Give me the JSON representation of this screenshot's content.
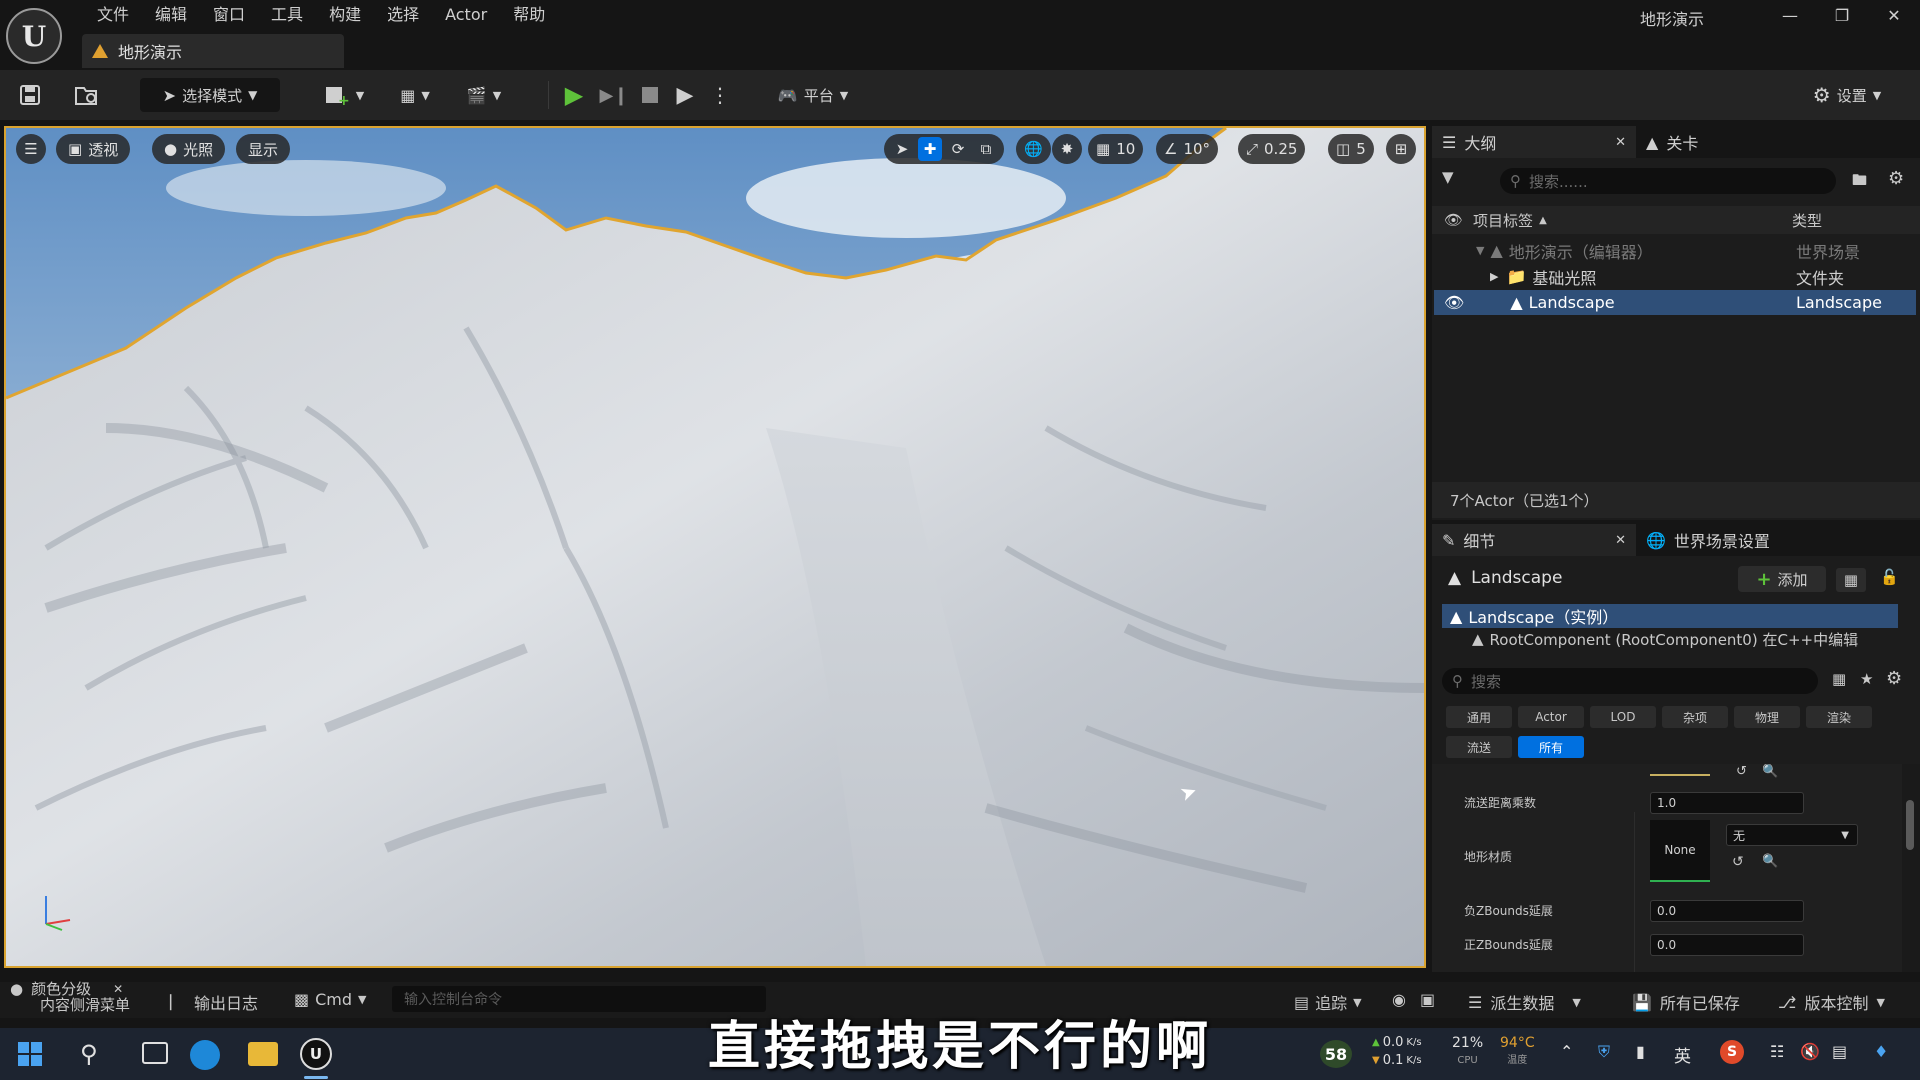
{
  "app": {
    "logo_letter": "U",
    "window_title": "地形演示",
    "menu": [
      "文件",
      "编辑",
      "窗口",
      "工具",
      "构建",
      "选择",
      "Actor",
      "帮助"
    ],
    "doc_tab": "地形演示"
  },
  "toolbar": {
    "select_mode": "选择模式",
    "platform": "平台",
    "settings": "设置"
  },
  "viewport": {
    "perspective": "透视",
    "lighting": "光照",
    "show": "显示",
    "grid_snap": "10",
    "rotate_snap": "10°",
    "scale_snap": "0.25",
    "camera_speed": "5"
  },
  "outliner": {
    "tab_outliner": "大纲",
    "tab_levels": "关卡",
    "search_placeholder": "搜索......",
    "col_label": "项目标签",
    "col_type": "类型",
    "rows": [
      {
        "label": "地形演示（编辑器）",
        "type": "世界场景"
      },
      {
        "label": "基础光照",
        "type": "文件夹"
      },
      {
        "label": "Landscape",
        "type": "Landscape"
      }
    ],
    "footer": "7个Actor（已选1个）"
  },
  "details": {
    "tab_details": "细节",
    "tab_world_settings": "世界场景设置",
    "actor_name": "Landscape",
    "add_label": "添加",
    "instance": "Landscape（实例）",
    "component": "RootComponent (RootComponent0)  在C++中编辑",
    "search_placeholder": "搜索",
    "categories_row1": [
      "通用",
      "Actor",
      "LOD",
      "杂项",
      "物理",
      "渲染"
    ],
    "categories_row2": [
      "流送",
      "所有"
    ],
    "active_category": "所有",
    "props": {
      "streaming_distance_label": "流送距离乘数",
      "streaming_distance_value": "1.0",
      "material_label": "地形材质",
      "material_thumb": "None",
      "material_value": "无",
      "neg_z_label": "负ZBounds延展",
      "neg_z_value": "0.0",
      "pos_z_label": "正ZBounds延展",
      "pos_z_value": "0.0"
    }
  },
  "statusbar": {
    "color_grade": "颜色分级",
    "content_menu": "内容侧滑菜单",
    "output_log": "输出日志",
    "cmd": "Cmd",
    "cmd_placeholder": "输入控制台命令",
    "trace": "追踪",
    "derived_data": "派生数据",
    "all_saved": "所有已保存",
    "source_control": "版本控制"
  },
  "taskbar": {
    "fps_badge": "58",
    "net_up": "0.0",
    "net_down": "0.1",
    "net_unit": "K/s",
    "cpu_value": "21%",
    "cpu_label": "CPU",
    "temp_value": "94°C",
    "temp_label": "温度",
    "ime": "英"
  },
  "subtitle": "直接拖拽是不行的啊",
  "colors": {
    "accent_orange": "#d9a330",
    "selection_blue": "#2f4f78",
    "active_blue": "#0070e0",
    "play_green": "#5ec23a"
  }
}
